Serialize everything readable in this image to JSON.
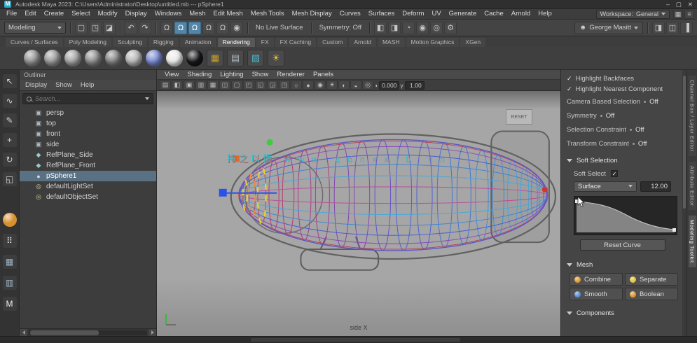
{
  "window": {
    "title": "Autodesk Maya 2023: C:\\Users\\Administrator\\Desktop\\untitled.mb --- pSphere1",
    "controls": {
      "minimize": "–",
      "maximize": "▢",
      "close": "✕"
    }
  },
  "menu_bar": {
    "items": [
      "File",
      "Edit",
      "Create",
      "Select",
      "Modify",
      "Display",
      "Windows",
      "Mesh",
      "Edit Mesh",
      "Mesh Tools",
      "Mesh Display",
      "Curves",
      "Surfaces",
      "Deform",
      "UV",
      "Generate",
      "Cache",
      "Arnold",
      "Help"
    ],
    "workspace_label": "Workspace:",
    "workspace_value": "General",
    "right_icons": [
      {
        "name": "workspace-grid-icon",
        "glyph": "▦"
      },
      {
        "name": "panel-list-icon",
        "glyph": "≡"
      }
    ]
  },
  "status_line": {
    "menu_set": "Modeling",
    "file_icons": [
      {
        "name": "new-scene-icon",
        "glyph": "▢"
      },
      {
        "name": "open-scene-icon",
        "glyph": "◳"
      },
      {
        "name": "save-scene-icon",
        "glyph": "◪"
      }
    ],
    "undo_redo_icons": [
      {
        "name": "undo-icon",
        "glyph": "↶"
      },
      {
        "name": "redo-icon",
        "glyph": "↷"
      }
    ],
    "snap_icons": [
      {
        "name": "snap-to-grid-icon",
        "glyph": "Ω"
      },
      {
        "name": "snap-to-curve-icon",
        "glyph": "Ω",
        "active": true
      },
      {
        "name": "snap-to-point-icon",
        "glyph": "Ω",
        "active": true
      },
      {
        "name": "snap-to-projected-center-icon",
        "glyph": "Ω"
      },
      {
        "name": "snap-to-view-plane-icon",
        "glyph": "Ω"
      },
      {
        "name": "make-live-icon",
        "glyph": "◉"
      }
    ],
    "no_live_surface": "No Live Surface",
    "symmetry": "Symmetry: Off",
    "history_icons": [
      {
        "name": "input-connections-icon",
        "glyph": "◧"
      },
      {
        "name": "output-connections-icon",
        "glyph": "◨"
      },
      {
        "name": "construction-history-icon",
        "glyph": "◔"
      },
      {
        "name": "render-frame-icon",
        "glyph": "◉"
      },
      {
        "name": "ipr-render-icon",
        "glyph": "◎"
      },
      {
        "name": "render-settings-icon",
        "glyph": "⚙"
      }
    ],
    "account": {
      "glyph": "☻",
      "label": "George Masitt"
    },
    "sidebar_toggles": [
      {
        "name": "toggle-attribute-editor-icon",
        "glyph": "◨"
      },
      {
        "name": "toggle-tool-settings-icon",
        "glyph": "◫"
      },
      {
        "name": "toggle-channel-box-icon",
        "glyph": "▐"
      }
    ]
  },
  "shelf": {
    "tabs": [
      {
        "label": "Curves / Surfaces"
      },
      {
        "label": "Poly Modeling"
      },
      {
        "label": "Sculpting"
      },
      {
        "label": "Rigging"
      },
      {
        "label": "Animation"
      },
      {
        "label": "Rendering",
        "active": true
      },
      {
        "label": "FX"
      },
      {
        "label": "FX Caching"
      },
      {
        "label": "Custom"
      },
      {
        "label": "Arnold"
      },
      {
        "label": "MASH"
      },
      {
        "label": "Motion Graphics"
      },
      {
        "label": "XGen"
      }
    ],
    "items": [
      {
        "name": "standard-surface-ball",
        "kind": "ball",
        "color": "#8f8f8f"
      },
      {
        "name": "lambert-ball",
        "kind": "ball",
        "color": "#969696"
      },
      {
        "name": "blinn-ball",
        "kind": "ball",
        "color": "#a0a0a0"
      },
      {
        "name": "phong-ball",
        "kind": "ball",
        "color": "#898989"
      },
      {
        "name": "metal-ball",
        "kind": "ball",
        "color": "#7d7d7d"
      },
      {
        "name": "shiny-ball",
        "kind": "ball",
        "color": "#b4b4b4"
      },
      {
        "name": "blue-material-ball",
        "kind": "ball",
        "color": "#7585cc"
      },
      {
        "name": "white-material-ball",
        "kind": "ball",
        "color": "#e9e9e9"
      },
      {
        "name": "black-material-ball",
        "kind": "ball",
        "color": "#17171a"
      },
      {
        "name": "texture-checker-icon",
        "kind": "tile",
        "glyph": "▦",
        "color": "#c8a028"
      },
      {
        "name": "ramp-texture-icon",
        "kind": "tile",
        "glyph": "▤",
        "color": "#a8b4ba"
      },
      {
        "name": "ocean-texture-icon",
        "kind": "tile",
        "glyph": "▨",
        "color": "#4db6c8"
      },
      {
        "name": "light-icon",
        "kind": "tile",
        "glyph": "☀",
        "color": "#e0c040"
      }
    ]
  },
  "toolbox": {
    "tools": [
      {
        "name": "select-tool",
        "glyph": "↖"
      },
      {
        "name": "lasso-select-tool",
        "glyph": "∿"
      },
      {
        "name": "paint-select-tool",
        "glyph": "✎"
      },
      {
        "name": "move-tool",
        "glyph": "+"
      },
      {
        "name": "rotate-tool",
        "glyph": "↻"
      },
      {
        "name": "scale-tool",
        "glyph": "◱"
      }
    ],
    "extras": [
      {
        "name": "material-ball-item",
        "kind": "ball",
        "color": "#d8902e",
        "glyph": ""
      },
      {
        "name": "dice-item",
        "glyph": "⠿",
        "color": "#e8e8e8"
      },
      {
        "name": "layout-grid-item",
        "glyph": "▦",
        "color": "#9fb7c8"
      },
      {
        "name": "layout-split-item",
        "glyph": "▥",
        "color": "#9fb7c8"
      },
      {
        "name": "m-item",
        "glyph": "M",
        "color": "#f0f0f0"
      }
    ]
  },
  "outliner": {
    "title": "Outliner",
    "menus": [
      "Display",
      "Show",
      "Help"
    ],
    "search_placeholder": "Search...",
    "items": [
      {
        "label": "persp",
        "glyph": "▣",
        "color": "#aeb6be"
      },
      {
        "label": "top",
        "glyph": "▣",
        "color": "#aeb6be"
      },
      {
        "label": "front",
        "glyph": "▣",
        "color": "#aeb6be"
      },
      {
        "label": "side",
        "glyph": "▣",
        "color": "#aeb6be"
      },
      {
        "label": "RefPlane_Side",
        "glyph": "◆",
        "color": "#93ccd6"
      },
      {
        "label": "RefPlane_Front",
        "glyph": "◆",
        "color": "#93ccd6"
      },
      {
        "label": "pSphere1",
        "glyph": "●",
        "color": "#d4dae0",
        "selected": true
      },
      {
        "label": "defaultLightSet",
        "glyph": "◎",
        "color": "#d6d69c"
      },
      {
        "label": "defaultObjectSet",
        "glyph": "◎",
        "color": "#d6d69c"
      }
    ]
  },
  "viewport": {
    "menus": [
      "View",
      "Shading",
      "Lighting",
      "Show",
      "Renderer",
      "Panels"
    ],
    "toolbar_icons": [
      {
        "name": "select-camera-icon",
        "glyph": "▤"
      },
      {
        "name": "lock-camera-icon",
        "glyph": "◧"
      },
      {
        "name": "camera-attributes-icon",
        "glyph": "▣"
      },
      {
        "name": "bookmarks-icon",
        "glyph": "▥"
      },
      {
        "name": "image-plane-icon",
        "glyph": "▦"
      },
      {
        "name": "two-panes-icon",
        "glyph": "◫"
      },
      {
        "name": "film-gate-icon",
        "glyph": "▢"
      },
      {
        "name": "resolution-gate-icon",
        "glyph": "◰"
      },
      {
        "name": "gate-mask-icon",
        "glyph": "◱"
      },
      {
        "name": "field-chart-icon",
        "glyph": "◲"
      },
      {
        "name": "safe-action-icon",
        "glyph": "◳"
      },
      {
        "name": "wireframe-icon",
        "glyph": "○"
      },
      {
        "name": "smooth-shade-icon",
        "glyph": "●"
      },
      {
        "name": "textured-icon",
        "glyph": "◉"
      },
      {
        "name": "lights-icon",
        "glyph": "☀"
      },
      {
        "name": "shadows-icon",
        "glyph": "◐"
      },
      {
        "name": "screen-space-ao-icon",
        "glyph": "◒"
      },
      {
        "name": "anti-alias-icon",
        "glyph": "◎"
      }
    ],
    "exposure_glyph": "◑",
    "gamma_glyph": "γ",
    "exposure": "0.000",
    "gamma": "1.00",
    "reset_label": "RESET",
    "watermark": {
      "cjk": "持之以恒",
      "url": "www.qdnxxjb.cn"
    },
    "camera_label": "side X"
  },
  "toolkit": {
    "checks": [
      {
        "label": "Highlight Backfaces",
        "glyph": "✓"
      },
      {
        "label": "Highlight Nearest Component",
        "glyph": "✓"
      }
    ],
    "states": [
      {
        "label": "Camera Based Selection",
        "value": "Off"
      },
      {
        "label": "Symmetry",
        "value": "Off"
      },
      {
        "label": "Selection Constraint",
        "value": "Off"
      },
      {
        "label": "Transform Constraint",
        "value": "Off"
      }
    ],
    "soft": {
      "header": "Soft Selection",
      "soft_select_label": "Soft Select",
      "check_glyph": "✓",
      "falloff_mode": "Surface",
      "falloff_size": "12.00",
      "reset_button": "Reset Curve"
    },
    "mesh": {
      "header": "Mesh",
      "buttons": [
        {
          "label": "Combine",
          "color": "#e09a30"
        },
        {
          "label": "Separate",
          "color": "#e6c33a"
        },
        {
          "label": "Smooth",
          "color": "#5b8fd6"
        },
        {
          "label": "Boolean",
          "color": "#e09a30"
        }
      ]
    },
    "components_header": "Components"
  },
  "side_tabs": [
    {
      "label": "Channel Box / Layer Editor"
    },
    {
      "label": "Attribute Editor"
    },
    {
      "label": "Modeling Toolkit",
      "active": true
    }
  ]
}
